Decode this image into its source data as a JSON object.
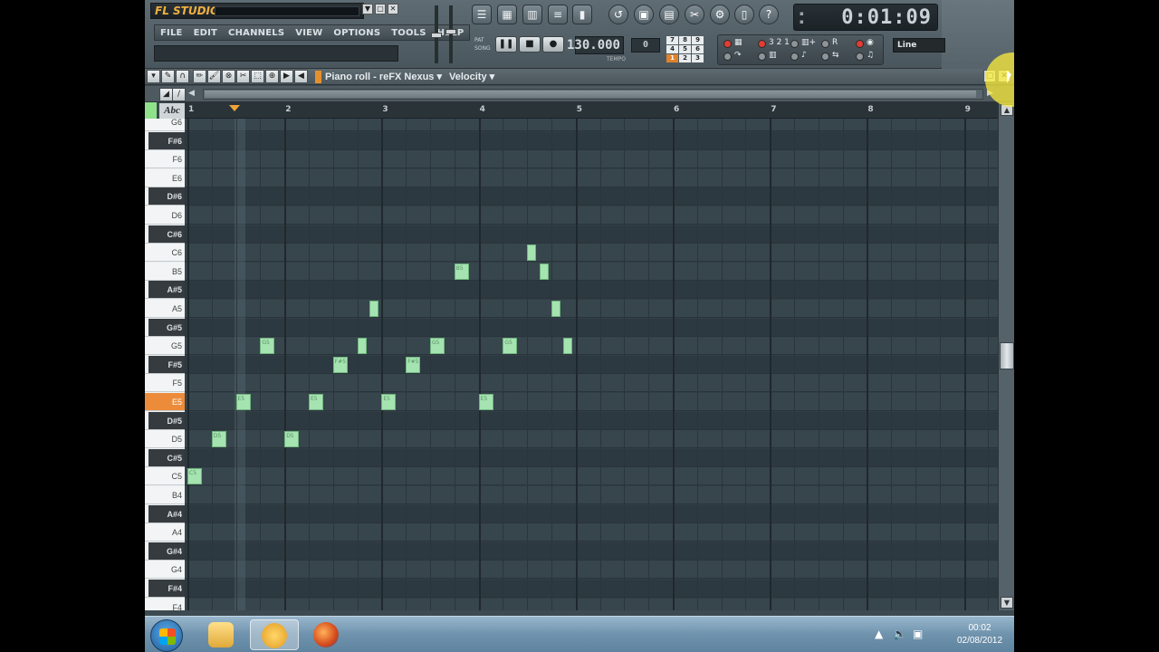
{
  "app": {
    "logo_text": "FL STUDIO",
    "menu": [
      "FILE",
      "EDIT",
      "CHANNELS",
      "VIEW",
      "OPTIONS",
      "TOOLS",
      "HELP"
    ],
    "time": "0:01:09",
    "tempo": "130.000",
    "tempo_label": "TEMPO",
    "pattern": "0",
    "pattern_label": "PAT",
    "pat_song": [
      "PAT",
      "SONG"
    ],
    "numpad": [
      "7",
      "8",
      "9",
      "4",
      "5",
      "6",
      "1",
      "2",
      "3"
    ],
    "numpad_active": "1",
    "snap_mode": "Line",
    "window_buttons": [
      "▼",
      "▢",
      "✕"
    ]
  },
  "piano_roll": {
    "title": "Piano roll - reFX Nexus",
    "target": "Velocity",
    "ruler_abc": "Abc",
    "bars": [
      "1",
      "2",
      "3",
      "4",
      "5",
      "6",
      "7",
      "8",
      "9"
    ],
    "keys": [
      "G6",
      "F#6",
      "F6",
      "E6",
      "D#6",
      "D6",
      "C#6",
      "C6",
      "B5",
      "A#5",
      "A5",
      "G#5",
      "G5",
      "F#5",
      "F5",
      "E5",
      "D#5",
      "D5",
      "C#5",
      "C5",
      "B4",
      "A#4",
      "A4",
      "G#4",
      "G4",
      "F#4",
      "F4"
    ],
    "active_key": "E5",
    "notes": [
      {
        "pitch": "C5",
        "beat": 0.0,
        "length": 0.75,
        "label": "C5"
      },
      {
        "pitch": "D5",
        "beat": 1.0,
        "length": 0.75,
        "label": "D5"
      },
      {
        "pitch": "E5",
        "beat": 2.0,
        "length": 0.75,
        "label": "E5"
      },
      {
        "pitch": "G5",
        "beat": 3.0,
        "length": 0.75,
        "label": "G5"
      },
      {
        "pitch": "D5",
        "beat": 4.0,
        "length": 0.75,
        "label": "D5"
      },
      {
        "pitch": "E5",
        "beat": 5.0,
        "length": 0.75,
        "label": "E5"
      },
      {
        "pitch": "F#5",
        "beat": 6.0,
        "length": 0.75,
        "label": "F#5"
      },
      {
        "pitch": "G5",
        "beat": 7.0,
        "length": 0.5,
        "label": ""
      },
      {
        "pitch": "A5",
        "beat": 7.5,
        "length": 0.5,
        "label": ""
      },
      {
        "pitch": "E5",
        "beat": 8.0,
        "length": 0.75,
        "label": "E5"
      },
      {
        "pitch": "F#5",
        "beat": 9.0,
        "length": 0.75,
        "label": "F#5"
      },
      {
        "pitch": "G5",
        "beat": 10.0,
        "length": 0.75,
        "label": "G5"
      },
      {
        "pitch": "B5",
        "beat": 11.0,
        "length": 0.75,
        "label": "B5"
      },
      {
        "pitch": "E5",
        "beat": 12.0,
        "length": 0.75,
        "label": "E5"
      },
      {
        "pitch": "G5",
        "beat": 13.0,
        "length": 0.75,
        "label": "G5"
      },
      {
        "pitch": "C6",
        "beat": 14.0,
        "length": 0.5,
        "label": ""
      },
      {
        "pitch": "B5",
        "beat": 14.5,
        "length": 0.5,
        "label": ""
      },
      {
        "pitch": "A5",
        "beat": 15.0,
        "length": 0.5,
        "label": ""
      },
      {
        "pitch": "G5",
        "beat": 15.5,
        "length": 0.5,
        "label": ""
      }
    ]
  },
  "taskbar": {
    "time": "00:02",
    "date": "02/08/2012",
    "apps": [
      "explorer-icon",
      "fl-studio-icon",
      "firefox-icon"
    ]
  }
}
